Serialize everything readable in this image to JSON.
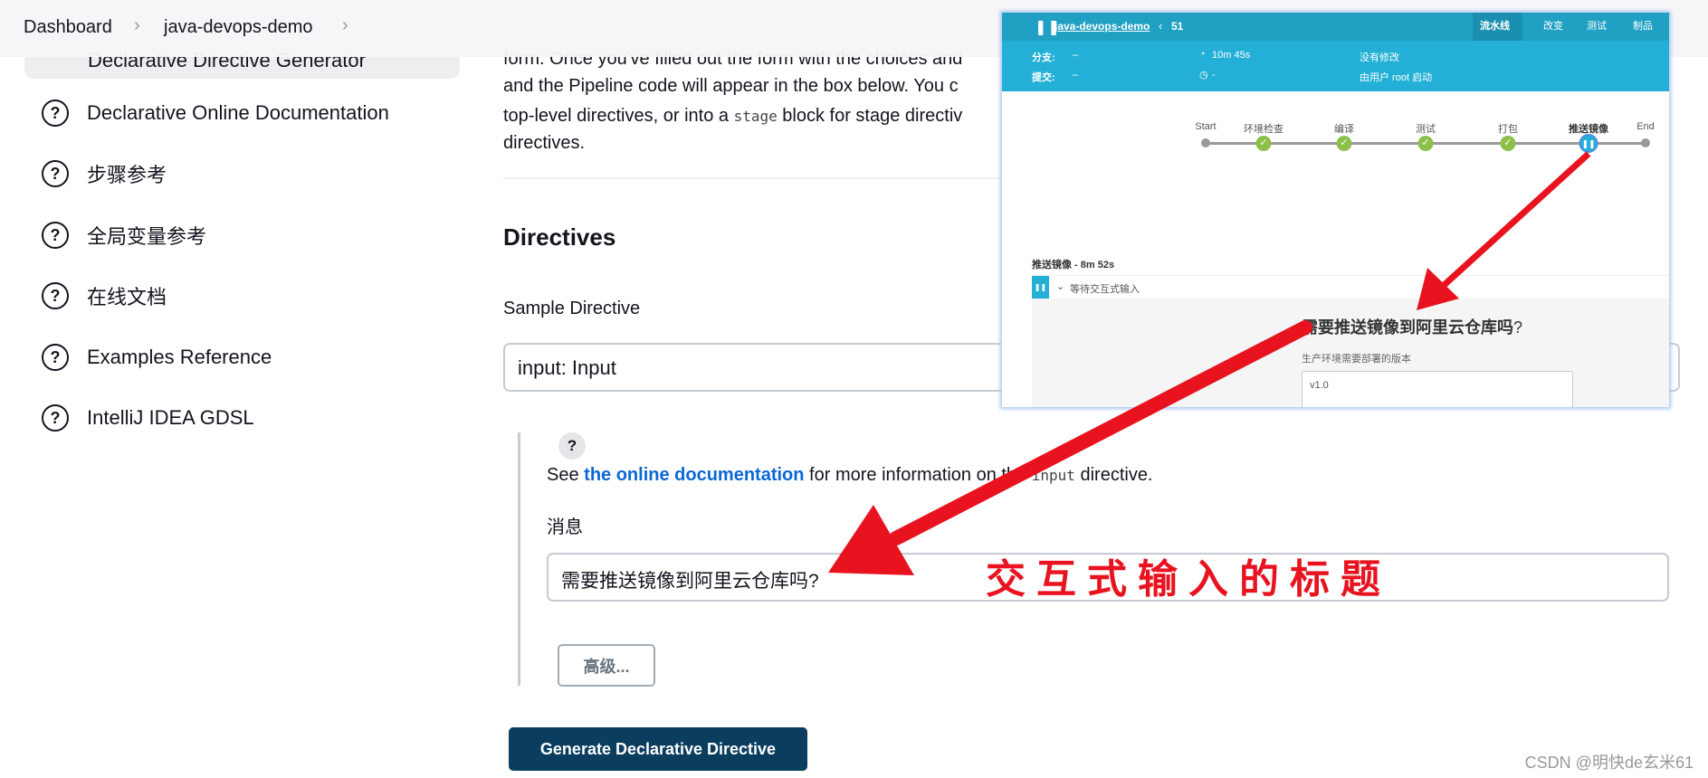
{
  "breadcrumb": [
    {
      "label": "Dashboard"
    },
    {
      "label": "java-devops-demo"
    }
  ],
  "sidebar": {
    "active_item": "Declarative Directive Generator",
    "items": [
      {
        "label": "Declarative Online Documentation",
        "icon": "help-circle-icon"
      },
      {
        "label": "步骤参考",
        "icon": "help-circle-icon"
      },
      {
        "label": "全局变量参考",
        "icon": "help-circle-icon"
      },
      {
        "label": "在线文档",
        "icon": "help-circle-icon"
      },
      {
        "label": "Examples Reference",
        "icon": "help-circle-icon"
      },
      {
        "label": "IntelliJ IDEA GDSL",
        "icon": "help-circle-icon"
      }
    ]
  },
  "main": {
    "intro_lines": [
      "form. Once you've filled out the form with the choices and",
      "and the Pipeline code will appear in the box below. You c",
      "top-level directives, or into a ",
      "directives."
    ],
    "intro_code": "stage",
    "intro_after_code": " block for stage directiv",
    "directives_heading": "Directives",
    "sample_label": "Sample Directive",
    "sample_value": "input: Input",
    "help_q": "?",
    "see_prefix": "See ",
    "see_link": "the online documentation",
    "see_mid": " for more information on the ",
    "see_code": "input",
    "see_suffix": " directive.",
    "message_label": "消息",
    "message_value": "需要推送镜像到阿里云仓库吗?",
    "advanced_button": "高级...",
    "generate_button": "Generate Declarative Directive"
  },
  "popup": {
    "job": "java-devops-demo",
    "build": "51",
    "tabs": [
      {
        "label": "流水线",
        "active": true
      },
      {
        "label": "改变"
      },
      {
        "label": "测试"
      },
      {
        "label": "制品"
      }
    ],
    "branch_label": "分支:",
    "branch_value": "–",
    "commit_label": "提交:",
    "commit_value": "–",
    "duration": "10m 45s",
    "time": "-",
    "changes": "没有修改",
    "started_by": "由用户 root 启动",
    "stages": [
      {
        "label": "Start",
        "status": "start"
      },
      {
        "label": "环境检查",
        "status": "success"
      },
      {
        "label": "编译",
        "status": "success"
      },
      {
        "label": "测试",
        "status": "success"
      },
      {
        "label": "打包",
        "status": "success"
      },
      {
        "label": "推送镜像",
        "status": "paused"
      },
      {
        "label": "End",
        "status": "end"
      }
    ],
    "stage_title": "推送镜像 - 8m 52s",
    "step_label": "等待交互式输入",
    "input_title": "需要推送镜像到阿里云仓库吗",
    "input_title_q": "?",
    "param_label": "生产环境需要部署的版本",
    "param_value": "v1.0",
    "colors": {
      "header": "#20a0c2",
      "info": "#24b0d6",
      "success": "#8cc04b"
    }
  },
  "annotation": "交互式输入的标题",
  "watermark": "CSDN @明快de玄米61",
  "colors": {
    "arrow": "#e8131f",
    "primary_button": "#0b3d5e",
    "link": "#0b66d6"
  }
}
